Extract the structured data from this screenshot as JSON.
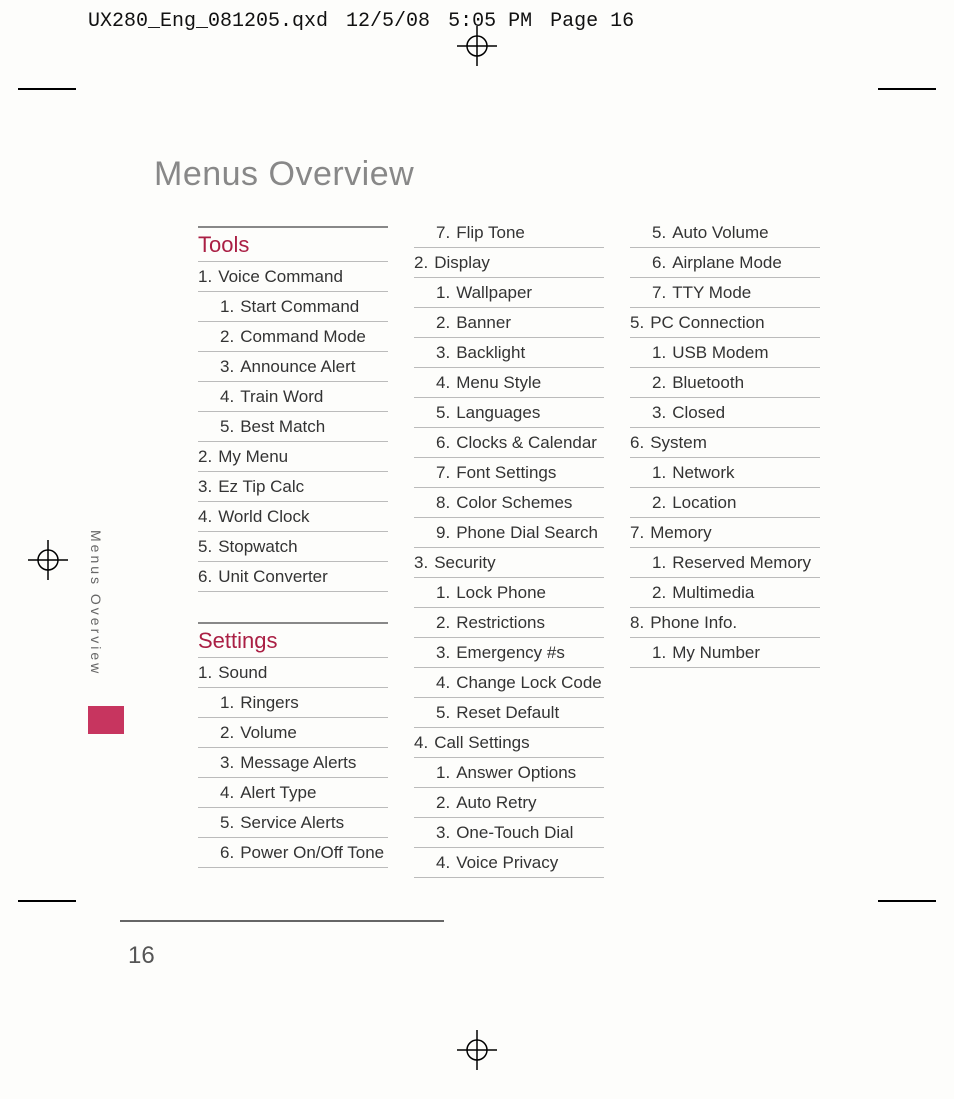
{
  "print_header": {
    "file": "UX280_Eng_081205.qxd",
    "date": "12/5/08",
    "time": "5:05 PM",
    "page": "Page 16"
  },
  "title": "Menus Overview",
  "side_tab": "Menus Overview",
  "page_number": "16",
  "sections": {
    "tools": {
      "head": "Tools",
      "items": [
        {
          "n": "1.",
          "t": "Voice Command",
          "sub": [
            {
              "n": "1.",
              "t": "Start Command"
            },
            {
              "n": "2.",
              "t": "Command Mode"
            },
            {
              "n": "3.",
              "t": "Announce Alert"
            },
            {
              "n": "4.",
              "t": "Train Word"
            },
            {
              "n": "5.",
              "t": "Best Match"
            }
          ]
        },
        {
          "n": "2.",
          "t": "My Menu"
        },
        {
          "n": "3.",
          "t": "Ez Tip Calc"
        },
        {
          "n": "4.",
          "t": "World Clock"
        },
        {
          "n": "5.",
          "t": "Stopwatch"
        },
        {
          "n": "6.",
          "t": "Unit Converter"
        }
      ]
    },
    "settings": {
      "head": "Settings",
      "items": [
        {
          "n": "1.",
          "t": "Sound",
          "sub": [
            {
              "n": "1.",
              "t": "Ringers"
            },
            {
              "n": "2.",
              "t": "Volume"
            },
            {
              "n": "3.",
              "t": "Message Alerts"
            },
            {
              "n": "4.",
              "t": "Alert Type"
            },
            {
              "n": "5.",
              "t": "Service Alerts"
            },
            {
              "n": "6.",
              "t": "Power On/Off Tone"
            },
            {
              "n": "7.",
              "t": "Flip Tone"
            }
          ]
        },
        {
          "n": "2.",
          "t": "Display",
          "sub": [
            {
              "n": "1.",
              "t": "Wallpaper"
            },
            {
              "n": "2.",
              "t": "Banner"
            },
            {
              "n": "3.",
              "t": "Backlight"
            },
            {
              "n": "4.",
              "t": "Menu Style"
            },
            {
              "n": "5.",
              "t": "Languages"
            },
            {
              "n": "6.",
              "t": "Clocks & Calendar"
            },
            {
              "n": "7.",
              "t": "Font Settings"
            },
            {
              "n": "8.",
              "t": "Color Schemes"
            },
            {
              "n": "9.",
              "t": "Phone Dial Search"
            }
          ]
        },
        {
          "n": "3.",
          "t": "Security",
          "sub": [
            {
              "n": "1.",
              "t": "Lock Phone"
            },
            {
              "n": "2.",
              "t": "Restrictions"
            },
            {
              "n": "3.",
              "t": "Emergency #s"
            },
            {
              "n": "4.",
              "t": "Change Lock Code"
            },
            {
              "n": "5.",
              "t": "Reset Default"
            }
          ]
        },
        {
          "n": "4.",
          "t": "Call Settings",
          "sub": [
            {
              "n": "1.",
              "t": "Answer Options"
            },
            {
              "n": "2.",
              "t": "Auto Retry"
            },
            {
              "n": "3.",
              "t": "One-Touch Dial"
            },
            {
              "n": "4.",
              "t": "Voice Privacy"
            },
            {
              "n": "5.",
              "t": "Auto Volume"
            },
            {
              "n": "6.",
              "t": "Airplane Mode"
            },
            {
              "n": "7.",
              "t": "TTY Mode"
            }
          ]
        },
        {
          "n": "5.",
          "t": "PC Connection",
          "sub": [
            {
              "n": "1.",
              "t": "USB Modem"
            },
            {
              "n": "2.",
              "t": "Bluetooth"
            },
            {
              "n": "3.",
              "t": "Closed"
            }
          ]
        },
        {
          "n": "6.",
          "t": "System",
          "sub": [
            {
              "n": "1.",
              "t": "Network"
            },
            {
              "n": "2.",
              "t": "Location"
            }
          ]
        },
        {
          "n": "7.",
          "t": "Memory",
          "sub": [
            {
              "n": "1.",
              "t": "Reserved Memory"
            },
            {
              "n": "2.",
              "t": "Multimedia"
            }
          ]
        },
        {
          "n": "8.",
          "t": "Phone Info.",
          "sub": [
            {
              "n": "1.",
              "t": "My Number"
            }
          ]
        }
      ]
    }
  }
}
